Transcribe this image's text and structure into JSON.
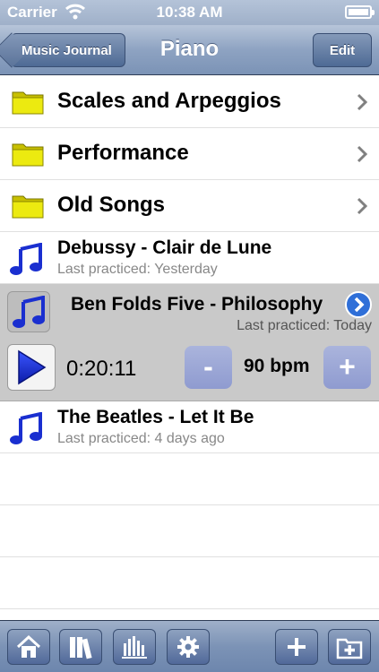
{
  "status_bar": {
    "carrier": "Carrier",
    "time": "10:38 AM"
  },
  "nav": {
    "back_label": "Music Journal",
    "title": "Piano",
    "edit_label": "Edit"
  },
  "folders": [
    {
      "label": "Scales and Arpeggios"
    },
    {
      "label": "Performance"
    },
    {
      "label": "Old Songs"
    }
  ],
  "songs": {
    "debussy": {
      "title": "Debussy - Clair de Lune",
      "subtitle": "Last practiced: Yesterday"
    },
    "philosophy": {
      "title": "Ben Folds Five - Philosophy",
      "subtitle": "Last practiced: Today"
    },
    "beatles": {
      "title": "The Beatles - Let It Be",
      "subtitle": "Last practiced: 4 days ago"
    }
  },
  "player": {
    "elapsed": "0:20:11",
    "tempo": "90 bpm",
    "minus_label": "-",
    "plus_label": "+"
  },
  "colors": {
    "folder": "#e6e600",
    "note": "#1a2fd0",
    "accent": "#2f6fd8"
  },
  "toolbar": {
    "icons": [
      "home-icon",
      "library-icon",
      "stats-icon",
      "settings-icon",
      "add-icon",
      "add-folder-icon"
    ]
  }
}
